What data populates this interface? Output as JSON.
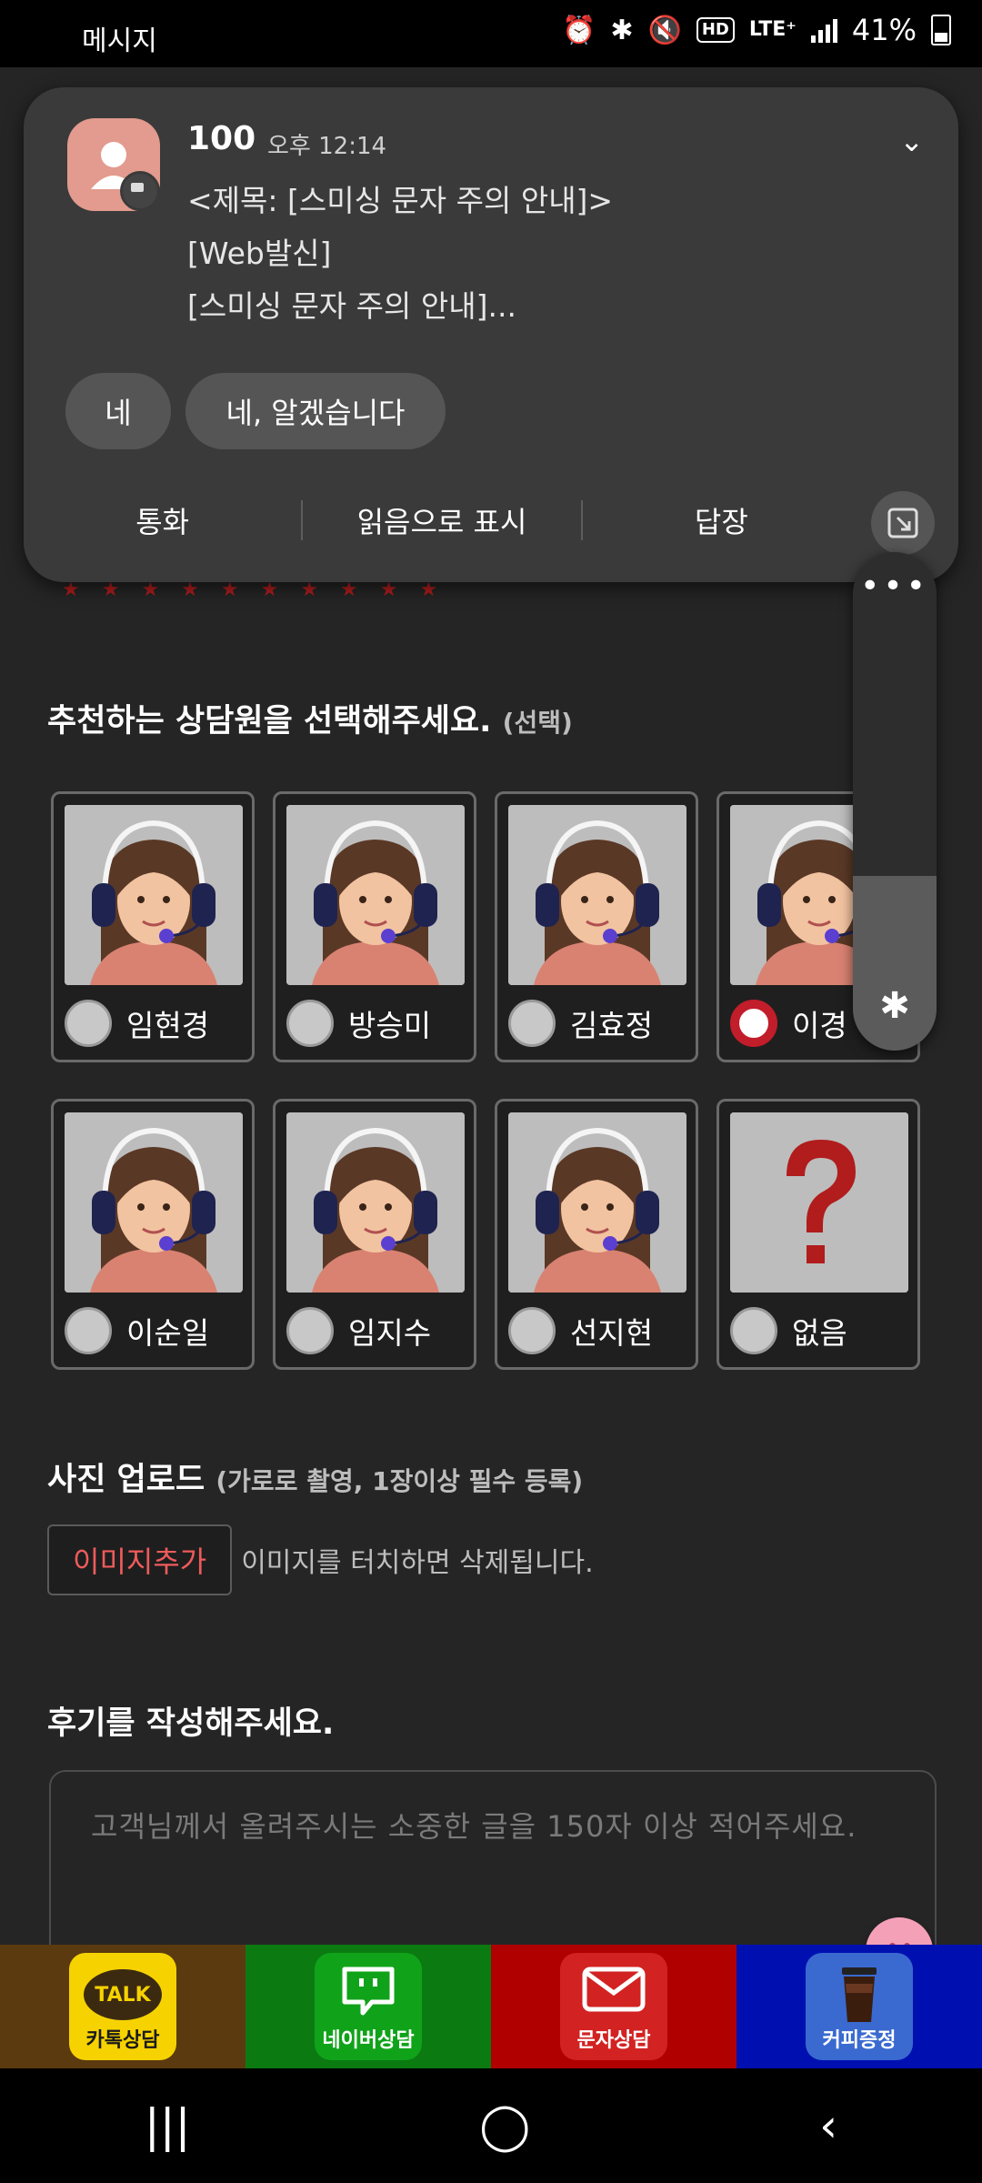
{
  "status_bar": {
    "left_text": "메시지",
    "battery": "41%",
    "lte": "LTE⁺",
    "hd": "HD"
  },
  "notification": {
    "sender": "100",
    "time": "오후 12:14",
    "line1": "<제목: [스미싱 문자 주의 안내]>",
    "line2": "[Web발신]",
    "line3": "[스미싱 문자 주의 안내]...",
    "quick_replies": [
      "네",
      "네, 알겠습니다"
    ],
    "actions": [
      "통화",
      "읽음으로 표시",
      "답장"
    ]
  },
  "volume": {
    "level": 0.35,
    "dots": "•••"
  },
  "counselor_section": {
    "title": "추천하는 상담원을 선택해주세요.",
    "sub": "(선택)"
  },
  "counselors": [
    {
      "name": "임현경",
      "selected": false,
      "type": "person"
    },
    {
      "name": "방승미",
      "selected": false,
      "type": "person"
    },
    {
      "name": "김효정",
      "selected": false,
      "type": "person"
    },
    {
      "name": "이경",
      "selected": true,
      "type": "person"
    },
    {
      "name": "이순일",
      "selected": false,
      "type": "person"
    },
    {
      "name": "임지수",
      "selected": false,
      "type": "person"
    },
    {
      "name": "선지현",
      "selected": false,
      "type": "person"
    },
    {
      "name": "없음",
      "selected": false,
      "type": "question"
    }
  ],
  "photo_section": {
    "title": "사진 업로드",
    "sub": "(가로로 촬영, 1장이상 필수 등록)",
    "add_button": "이미지추가",
    "hint": "이미지를 터치하면 삭제됩니다."
  },
  "review_section": {
    "title": "후기를 작성해주세요.",
    "placeholder": "고객님께서 올려주시는 소중한 글을 150자 이상 적어주세요."
  },
  "contact_bar": [
    {
      "label": "카톡상담",
      "icon": "talk-icon",
      "icon_text": "TALK",
      "bg": "#5b3a10",
      "tile": "#f6d300"
    },
    {
      "label": "네이버상담",
      "icon": "naver-talk-icon",
      "bg": "#0b7a11",
      "tile": "#10a31a"
    },
    {
      "label": "문자상담",
      "icon": "envelope-icon",
      "bg": "#b00000",
      "tile": "#d22222"
    },
    {
      "label": "커피증정",
      "icon": "coffee-icon",
      "bg": "#0010b0",
      "tile": "#3a6ad0"
    }
  ],
  "nav": {
    "recent": "|||",
    "home": "◯",
    "back": "‹"
  }
}
